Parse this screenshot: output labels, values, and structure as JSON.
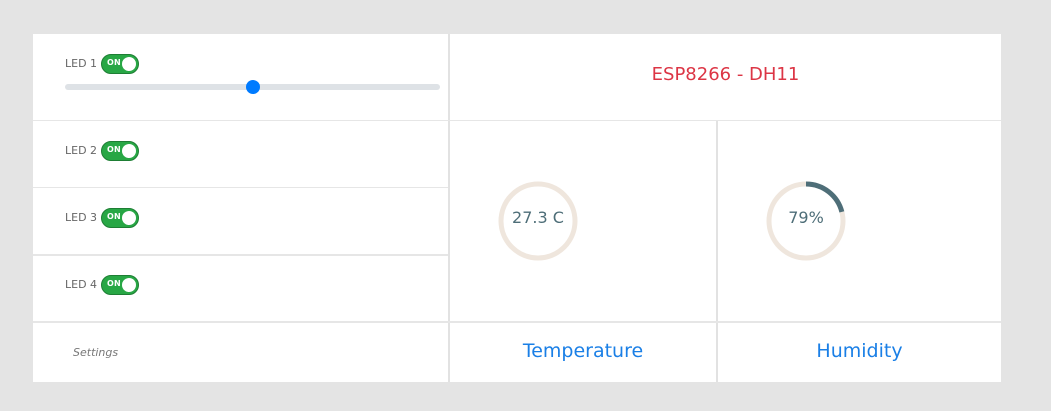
{
  "leds": [
    {
      "label": "LED 1",
      "toggle": "ON",
      "slider_value": 0.5
    },
    {
      "label": "LED 2",
      "toggle": "ON"
    },
    {
      "label": "LED 3",
      "toggle": "ON"
    },
    {
      "label": "LED 4",
      "toggle": "ON"
    }
  ],
  "settings_label": "Settings",
  "device_title": "ESP8266 - DH11",
  "temperature": {
    "value": "27.3 C",
    "caption": "Temperature",
    "fill_fraction": 0
  },
  "humidity": {
    "value": "79%",
    "caption": "Humidity",
    "fill_fraction": 0.21
  },
  "colors": {
    "toggle_on": "#28a745",
    "slider_thumb": "#007bff",
    "title": "#dc3545",
    "caption": "#1a7fe6",
    "gauge_track": "#efe6dd",
    "gauge_fill": "#4e6e78"
  }
}
